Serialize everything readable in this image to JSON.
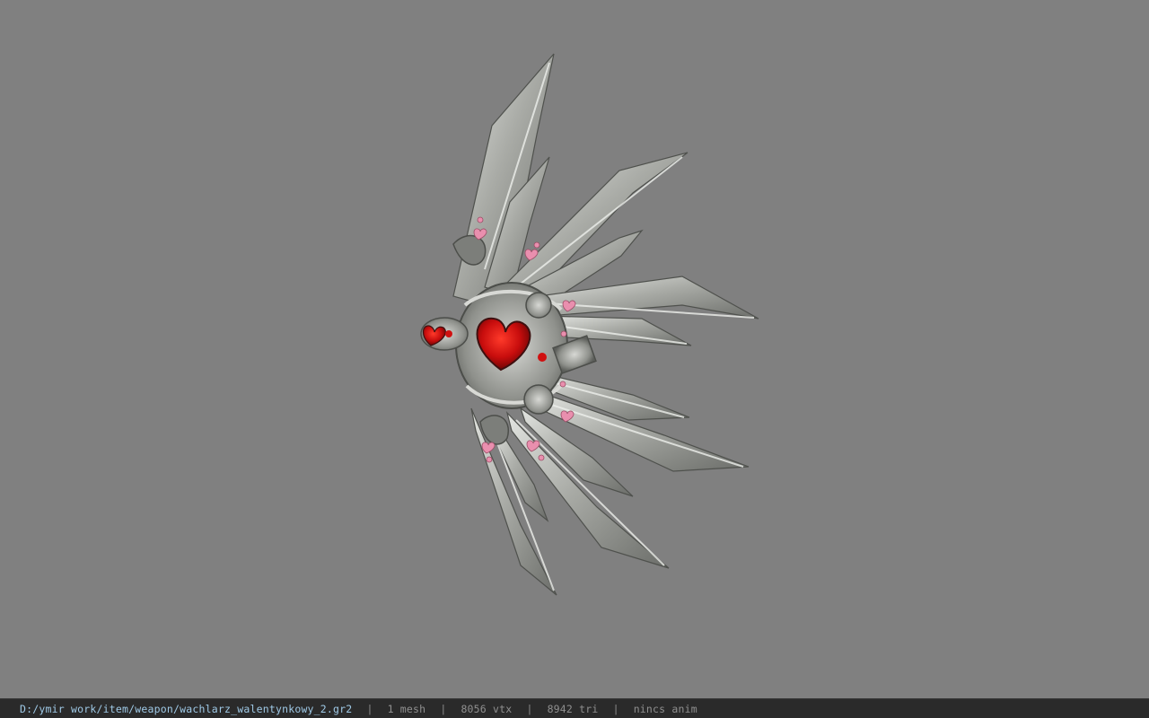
{
  "viewport": {
    "background": "#808080",
    "model": "fan-weapon-model",
    "blade_color": "#b8bab6",
    "gem_color": "#d01010",
    "accent_color": "#e98fae"
  },
  "statusbar": {
    "file_path": "D:/ymir work/item/weapon/wachlarz_walentynkowy_2.gr2",
    "separator": "|",
    "mesh_count": "1 mesh",
    "vertex_count": "8056 vtx",
    "triangle_count": "8942 tri",
    "anim": "nincs anim"
  }
}
